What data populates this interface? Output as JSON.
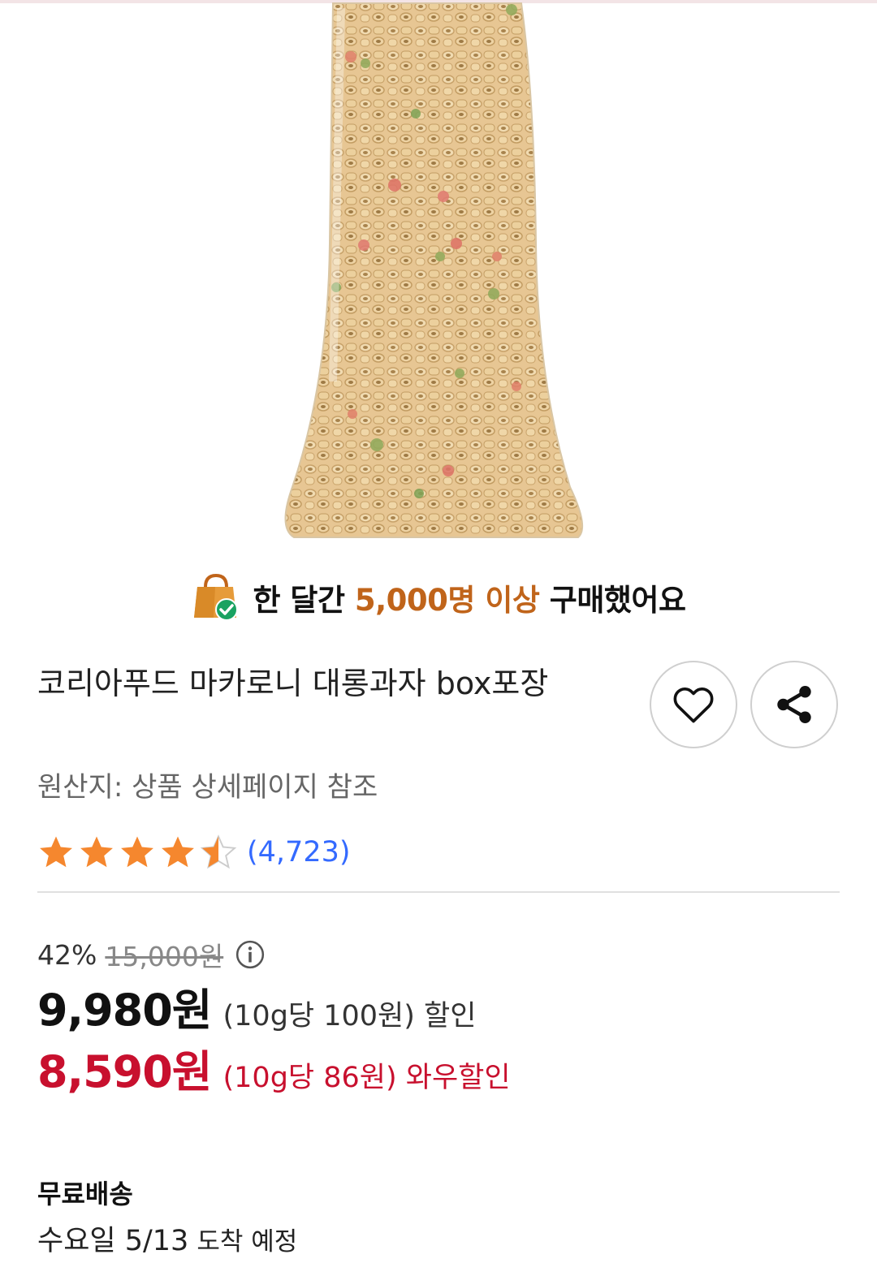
{
  "colors": {
    "accent_orange": "#c0641a",
    "sale_red": "#c8102e",
    "review_blue": "#346aff",
    "star_orange": "#f5872e"
  },
  "banner": {
    "icon": "shopping-bag-check-icon",
    "prefix": "한 달간 ",
    "highlight": "5,000명 이상",
    "suffix": " 구매했어요"
  },
  "product": {
    "image": "macaroni-snack-bag",
    "title": "코리아푸드 마카로니 대롱과자 box포장",
    "origin": "원산지: 상품 상세페이지 참조",
    "wish_icon": "heart-icon",
    "share_icon": "share-icon"
  },
  "rating": {
    "stars": 4.5,
    "review_count": "(4,723)"
  },
  "price": {
    "discount_rate": "42%",
    "original_price": "15,000원",
    "info_icon": "info-icon",
    "sale_price": "9,980원",
    "sale_unit": "(10g당 100원) 할인",
    "wow_price": "8,590원",
    "wow_unit": "(10g당 86원) 와우할인"
  },
  "shipping": {
    "title": "무료배송",
    "date_main": "수요일 5/13",
    "date_suffix": "도착 예정"
  }
}
